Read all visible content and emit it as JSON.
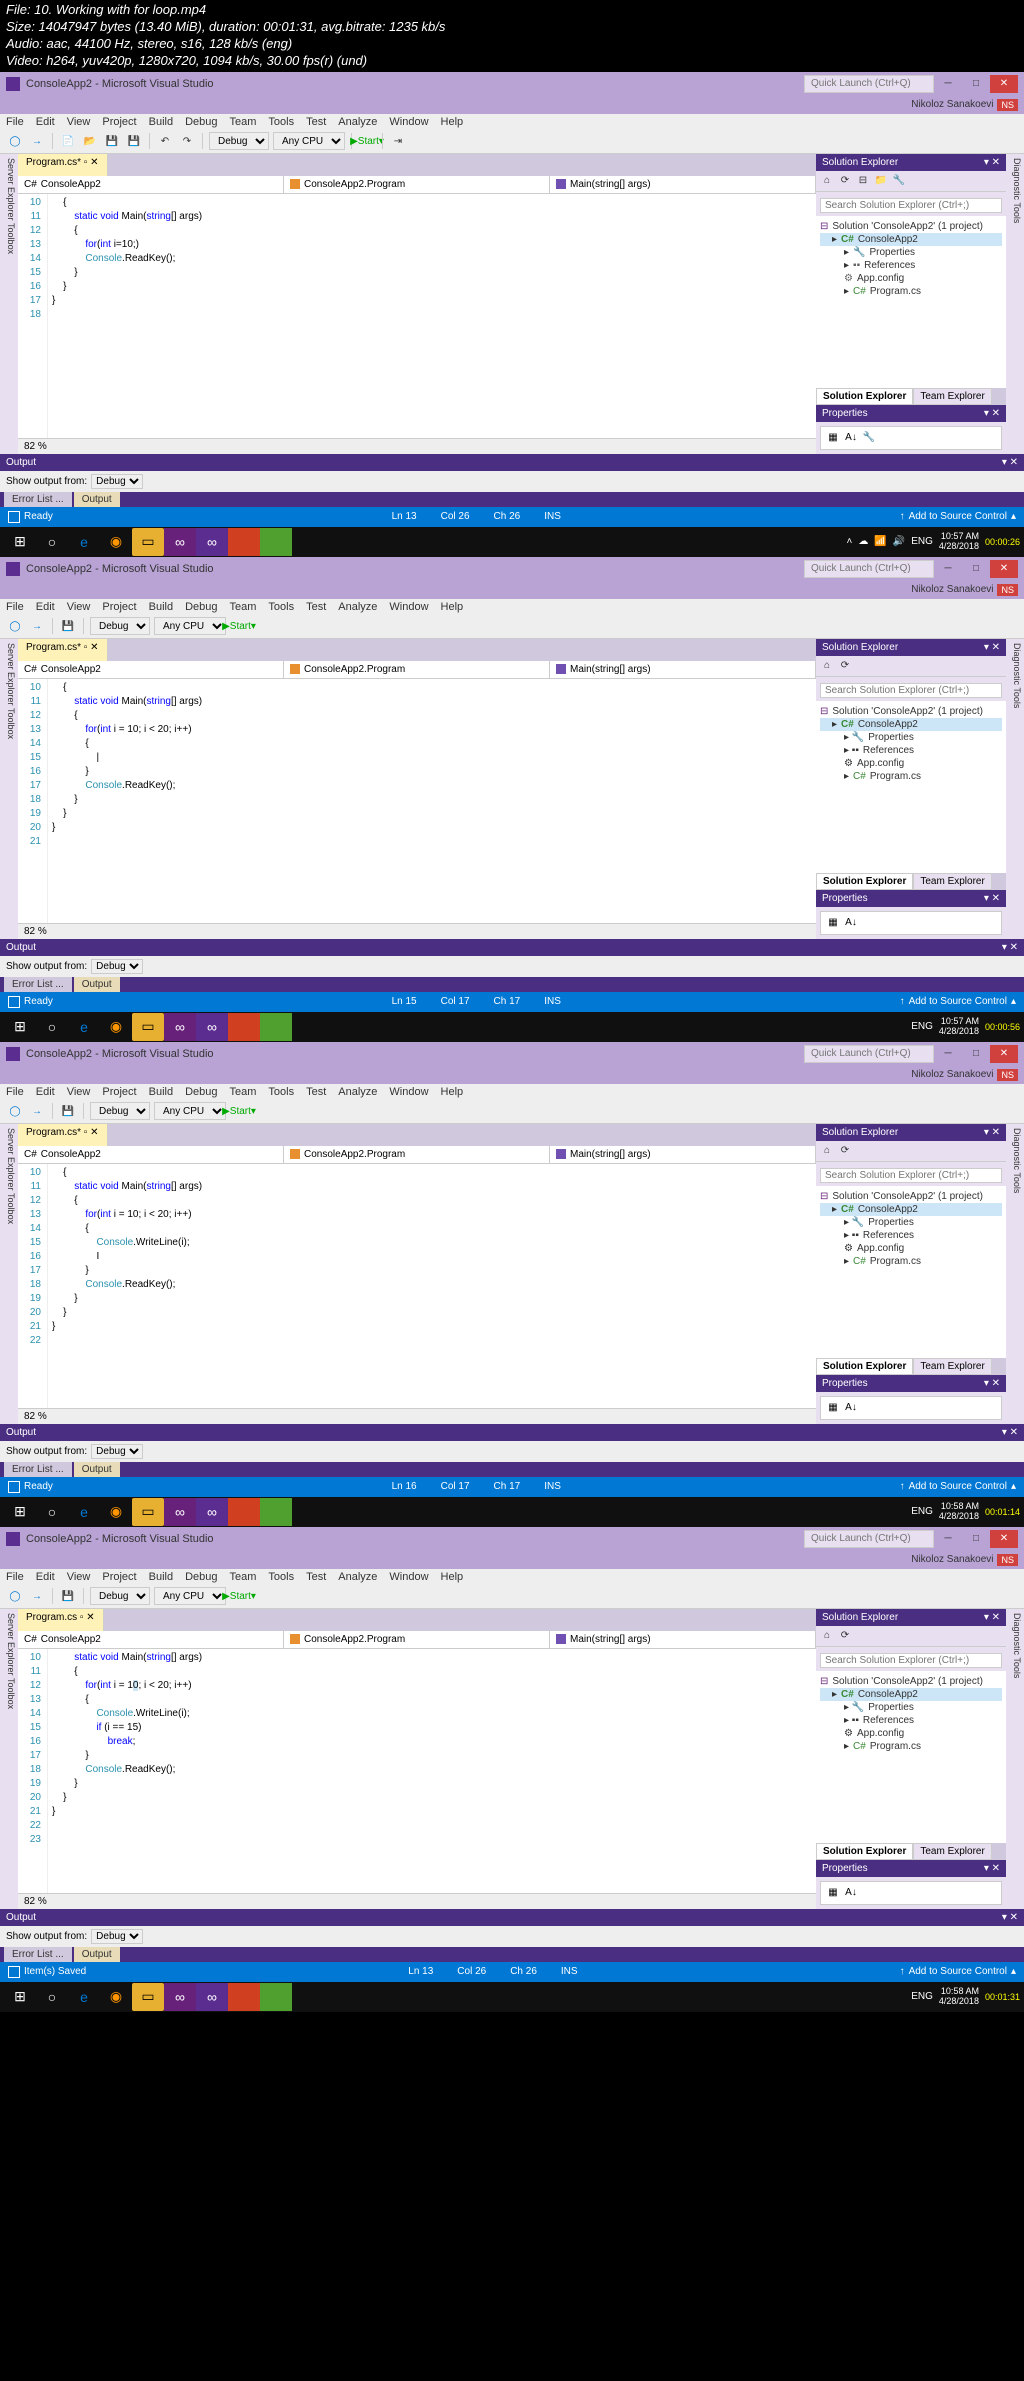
{
  "media": {
    "file": "File: 10. Working with for loop.mp4",
    "size": "Size: 14047947 bytes (13.40 MiB), duration: 00:01:31, avg.bitrate: 1235 kb/s",
    "audio": "Audio: aac, 44100 Hz, stereo, s16, 128 kb/s (eng)",
    "video": "Video: h264, yuv420p, 1280x720, 1094 kb/s, 30.00 fps(r) (und)"
  },
  "vs": {
    "title": "ConsoleApp2 - Microsoft Visual Studio",
    "quick_launch": "Quick Launch (Ctrl+Q)",
    "user": "Nikoloz Sanakoevi",
    "user_badge": "NS",
    "menu": [
      "File",
      "Edit",
      "View",
      "Project",
      "Build",
      "Debug",
      "Team",
      "Tools",
      "Test",
      "Analyze",
      "Window",
      "Help"
    ],
    "config": "Debug",
    "platform": "Any CPU",
    "start": "Start",
    "tab": "Program.cs*",
    "tab_saved": "Program.cs",
    "dd_project": "ConsoleApp2",
    "dd_class": "ConsoleApp2.Program",
    "dd_method": "Main(string[] args)",
    "zoom": "82 %",
    "output": "Output",
    "show_output": "Show output from:",
    "output_src": "Debug",
    "errlist": "Error List ...",
    "output_tab": "Output",
    "leftbar1": "Server Explorer",
    "leftbar2": "Toolbox",
    "rightbar": "Diagnostic Tools",
    "sol_exp": "Solution Explorer",
    "sol_search": "Search Solution Explorer (Ctrl+;)",
    "sln": "Solution 'ConsoleApp2' (1 project)",
    "proj": "ConsoleApp2",
    "props": "Properties",
    "refs": "References",
    "appcfg": "App.config",
    "progcs": "Program.cs",
    "sol_tab": "Solution Explorer",
    "team_tab": "Team Explorer",
    "prop_header": "Properties",
    "status_ready": "Ready",
    "status_saved": "Item(s) Saved",
    "source_ctrl": "Add to Source Control"
  },
  "frames": [
    {
      "lines": [
        "10",
        "11",
        "12",
        "13",
        "14",
        "15",
        "16",
        "17",
        "18"
      ],
      "status": {
        "ln": "Ln 13",
        "col": "Col 26",
        "ch": "Ch 26",
        "ins": "INS"
      },
      "tab_state": "dirty",
      "time": "10:57 AM",
      "date": "4/28/2018",
      "ts": "00:00:26"
    },
    {
      "lines": [
        "10",
        "11",
        "12",
        "13",
        "14",
        "15",
        "16",
        "17",
        "18",
        "19",
        "20",
        "21"
      ],
      "status": {
        "ln": "Ln 15",
        "col": "Col 17",
        "ch": "Ch 17",
        "ins": "INS"
      },
      "tab_state": "dirty",
      "time": "10:57 AM",
      "date": "4/28/2018",
      "ts": "00:00:56"
    },
    {
      "lines": [
        "10",
        "11",
        "12",
        "13",
        "14",
        "15",
        "16",
        "17",
        "18",
        "19",
        "20",
        "21",
        "22"
      ],
      "status": {
        "ln": "Ln 16",
        "col": "Col 17",
        "ch": "Ch 17",
        "ins": "INS"
      },
      "tab_state": "dirty",
      "time": "10:58 AM",
      "date": "4/28/2018",
      "ts": "00:01:14"
    },
    {
      "lines": [
        "10",
        "11",
        "12",
        "13",
        "14",
        "15",
        "16",
        "17",
        "18",
        "19",
        "20",
        "21",
        "22",
        "23"
      ],
      "status": {
        "ln": "Ln 13",
        "col": "Col 26",
        "ch": "Ch 26",
        "ins": "INS"
      },
      "tab_state": "saved",
      "time": "10:58 AM",
      "date": "4/28/2018",
      "ts": "00:01:31"
    }
  ],
  "taskbar": {
    "eng": "ENG"
  }
}
